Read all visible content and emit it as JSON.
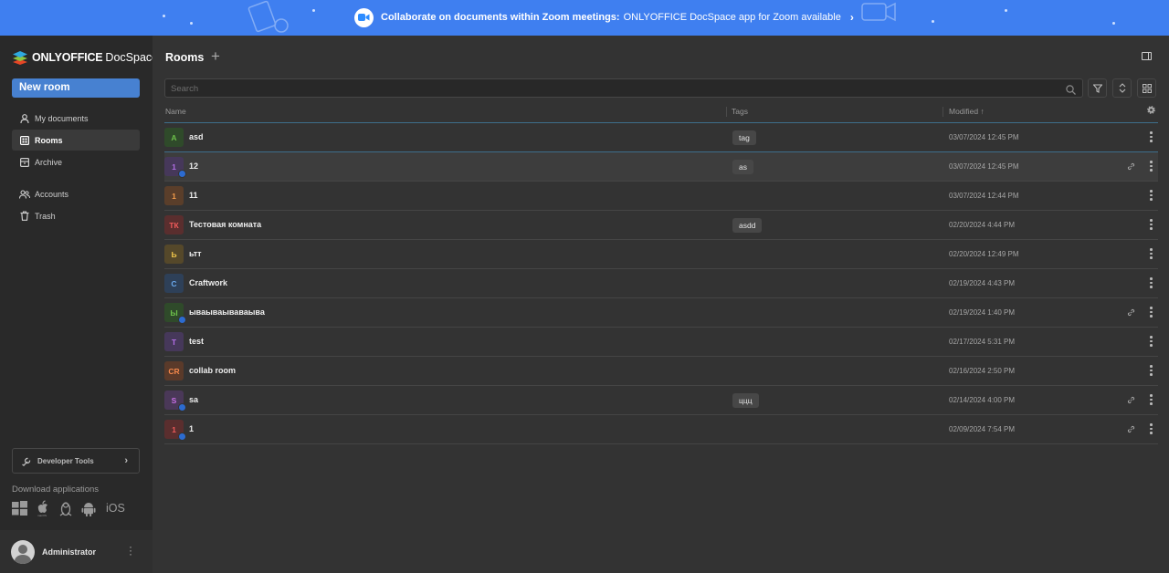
{
  "banner": {
    "bold_text": "Collaborate on documents within Zoom meetings:",
    "text": "ONLYOFFICE DocSpace app for Zoom available"
  },
  "sidebar": {
    "brand": "ONLYOFFICE",
    "brand_suffix": "DocSpace",
    "new_room_label": "New room",
    "nav": [
      {
        "label": "My documents",
        "icon": "person-icon"
      },
      {
        "label": "Rooms",
        "icon": "rooms-icon",
        "active": true
      },
      {
        "label": "Archive",
        "icon": "archive-icon"
      },
      {
        "label": "Accounts",
        "icon": "accounts-icon"
      },
      {
        "label": "Trash",
        "icon": "trash-icon"
      }
    ],
    "developer_tools": "Developer Tools",
    "download_label": "Download applications",
    "apps": [
      "windows-icon",
      "macos-icon",
      "linux-icon",
      "android-icon",
      "iOS"
    ],
    "user": "Administrator"
  },
  "main": {
    "title": "Rooms",
    "search_placeholder": "Search",
    "columns": {
      "name": "Name",
      "tags": "Tags",
      "modified": "Modified ↑"
    },
    "rooms": [
      {
        "initials": "A",
        "name": "asd",
        "tag": "tag",
        "modified": "03/07/2024 12:45 PM",
        "color": "#6cc04a",
        "bg": "#2f4a2a",
        "public": false,
        "link": false
      },
      {
        "initials": "1",
        "name": "12",
        "tag": "as",
        "modified": "03/07/2024 12:45 PM",
        "color": "#b36ee6",
        "bg": "#46385a",
        "public": true,
        "link": true
      },
      {
        "initials": "1",
        "name": "11",
        "tag": "",
        "modified": "03/07/2024 12:44 PM",
        "color": "#f39c4b",
        "bg": "#5a3e2a",
        "public": false,
        "link": false
      },
      {
        "initials": "ТК",
        "name": "Тестовая комната",
        "tag": "asdd",
        "modified": "02/20/2024 4:44 PM",
        "color": "#ef5a5a",
        "bg": "#5a2e2e",
        "public": false,
        "link": false
      },
      {
        "initials": "Ь",
        "name": "ьтт",
        "tag": "",
        "modified": "02/20/2024 12:49 PM",
        "color": "#f0c64a",
        "bg": "#55482a",
        "public": false,
        "link": false
      },
      {
        "initials": "C",
        "name": "Craftwork",
        "tag": "",
        "modified": "02/19/2024 4:43 PM",
        "color": "#6aa8ec",
        "bg": "#2e4058",
        "public": false,
        "link": false
      },
      {
        "initials": "Ы",
        "name": "ываываываваыва",
        "tag": "",
        "modified": "02/19/2024 1:40 PM",
        "color": "#6cc04a",
        "bg": "#2f4a2a",
        "public": true,
        "link": true
      },
      {
        "initials": "T",
        "name": "test",
        "tag": "",
        "modified": "02/17/2024 5:31 PM",
        "color": "#b36ee6",
        "bg": "#46385a",
        "public": false,
        "link": false
      },
      {
        "initials": "CR",
        "name": "collab room",
        "tag": "",
        "modified": "02/16/2024 2:50 PM",
        "color": "#f3874b",
        "bg": "#5a3a2a",
        "public": false,
        "link": false
      },
      {
        "initials": "S",
        "name": "sa",
        "tag": "ццц",
        "modified": "02/14/2024 4:00 PM",
        "color": "#c86ee6",
        "bg": "#4a3858",
        "public": true,
        "link": true
      },
      {
        "initials": "1",
        "name": "1",
        "tag": "",
        "modified": "02/09/2024 7:54 PM",
        "color": "#ef5a5a",
        "bg": "#5a2e2e",
        "public": true,
        "link": true
      }
    ]
  }
}
